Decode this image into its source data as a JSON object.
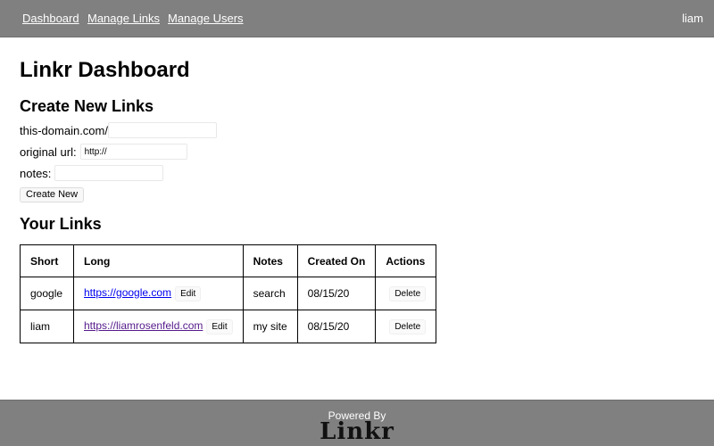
{
  "nav": {
    "items": [
      {
        "label": "Dashboard"
      },
      {
        "label": "Manage Links"
      },
      {
        "label": "Manage Users"
      }
    ],
    "user": "liam"
  },
  "page": {
    "title": "Linkr Dashboard",
    "create_title": "Create New Links",
    "short_label": "this-domain.com/",
    "short_value": "",
    "url_label": "original url:",
    "url_value": "http://",
    "notes_label": "notes:",
    "notes_value": "",
    "create_button": "Create New",
    "links_title": "Your Links"
  },
  "table": {
    "headers": [
      "Short",
      "Long",
      "Notes",
      "Created On",
      "Actions"
    ],
    "edit_label": "Edit",
    "delete_label": "Delete",
    "rows": [
      {
        "short": "google",
        "long": "https://google.com",
        "notes": "search",
        "created": "08/15/20"
      },
      {
        "short": "liam",
        "long": "https://liamrosenfeld.com",
        "notes": "my site",
        "created": "08/15/20"
      }
    ]
  },
  "footer": {
    "powered_by": "Powered By",
    "logo_text": "Linkr"
  }
}
